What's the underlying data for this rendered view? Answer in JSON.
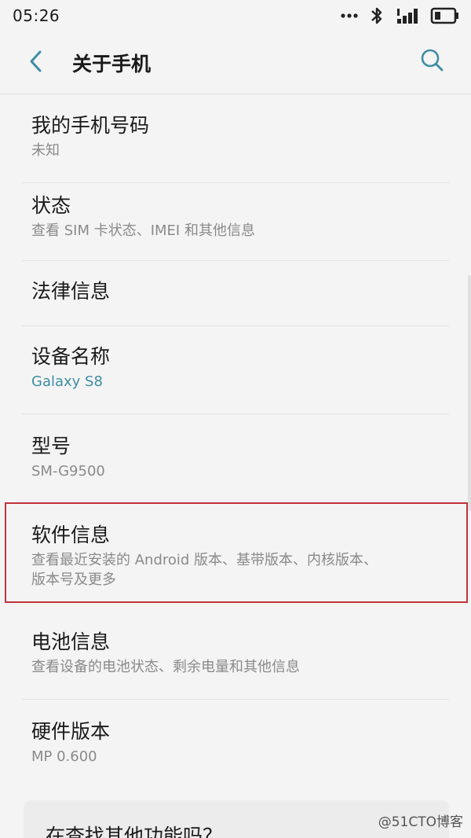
{
  "status_bar": {
    "time": "05:26",
    "icons": [
      "more-dots-icon",
      "bluetooth-icon",
      "signal-icon",
      "battery-icon"
    ]
  },
  "app_bar": {
    "title": "关于手机",
    "back_icon": "chevron-left-icon",
    "search_icon": "search-icon",
    "accent_color": "#3d8ea4"
  },
  "items": [
    {
      "title": "我的手机号码",
      "subtitle": "未知"
    },
    {
      "title": "状态",
      "subtitle": "查看 SIM 卡状态、IMEI 和其他信息"
    },
    {
      "title": "法律信息"
    },
    {
      "title": "设备名称",
      "subtitle": "Galaxy S8"
    },
    {
      "title": "型号",
      "subtitle": "SM-G9500"
    },
    {
      "title": "软件信息",
      "subtitle_line1": "查看最近安装的 Android 版本、基带版本、内核版本、",
      "subtitle_line2": "版本号及更多"
    },
    {
      "title": "电池信息",
      "subtitle": "查看设备的电池状态、剩余电量和其他信息"
    },
    {
      "title": "硬件版本",
      "subtitle": "MP 0.600"
    }
  ],
  "suggest_card": {
    "title": "在查找其他功能吗？"
  },
  "highlight_color": "#c0343a",
  "watermark": "@51CTO博客"
}
